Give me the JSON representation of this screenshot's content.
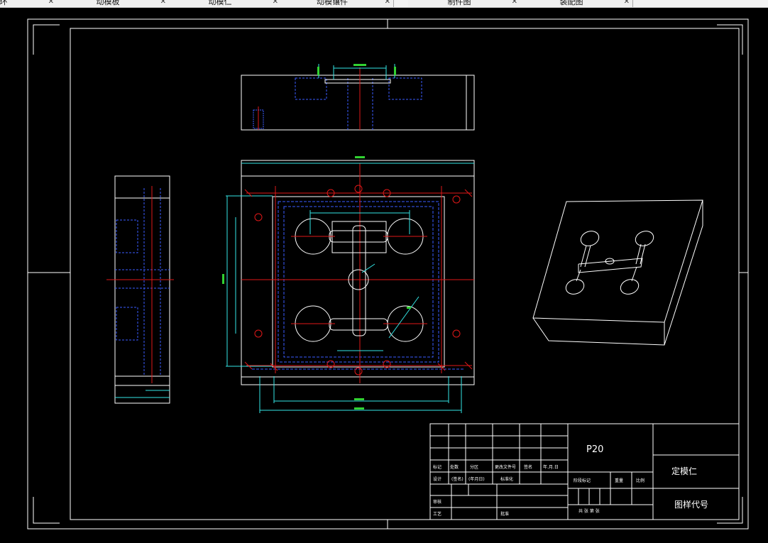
{
  "tabs": [
    {
      "label": "定位环"
    },
    {
      "label": "动模板"
    },
    {
      "label": "动模仁"
    },
    {
      "label": "动模镶件"
    },
    {
      "label": "制件图"
    },
    {
      "label": "装配图"
    }
  ],
  "title_block": {
    "material": "P20",
    "part_name": "定模仁",
    "drawing_code": "图样代号",
    "labels": {
      "mark": "标记",
      "count": "处数",
      "zone": "分区",
      "change_doc": "更改文件号",
      "sign": "签名",
      "date_ymd": "年.月.日",
      "design": "设计",
      "sign_paren": "(签名)",
      "date_paren": "(年月日)",
      "standardize": "标准化",
      "review": "审核",
      "process": "工艺",
      "approve": "批准",
      "stage_mark": "阶段标记",
      "weight": "重量",
      "scale": "比例",
      "sheet_info": "共 张 第 张"
    }
  },
  "colors": {
    "outline": "#ffffff",
    "dimension": "#33e6e6",
    "centerline": "#e01818",
    "hidden": "#3a5cff",
    "dim_text": "#32d232"
  },
  "icons": {
    "tab_close": "close-icon"
  }
}
